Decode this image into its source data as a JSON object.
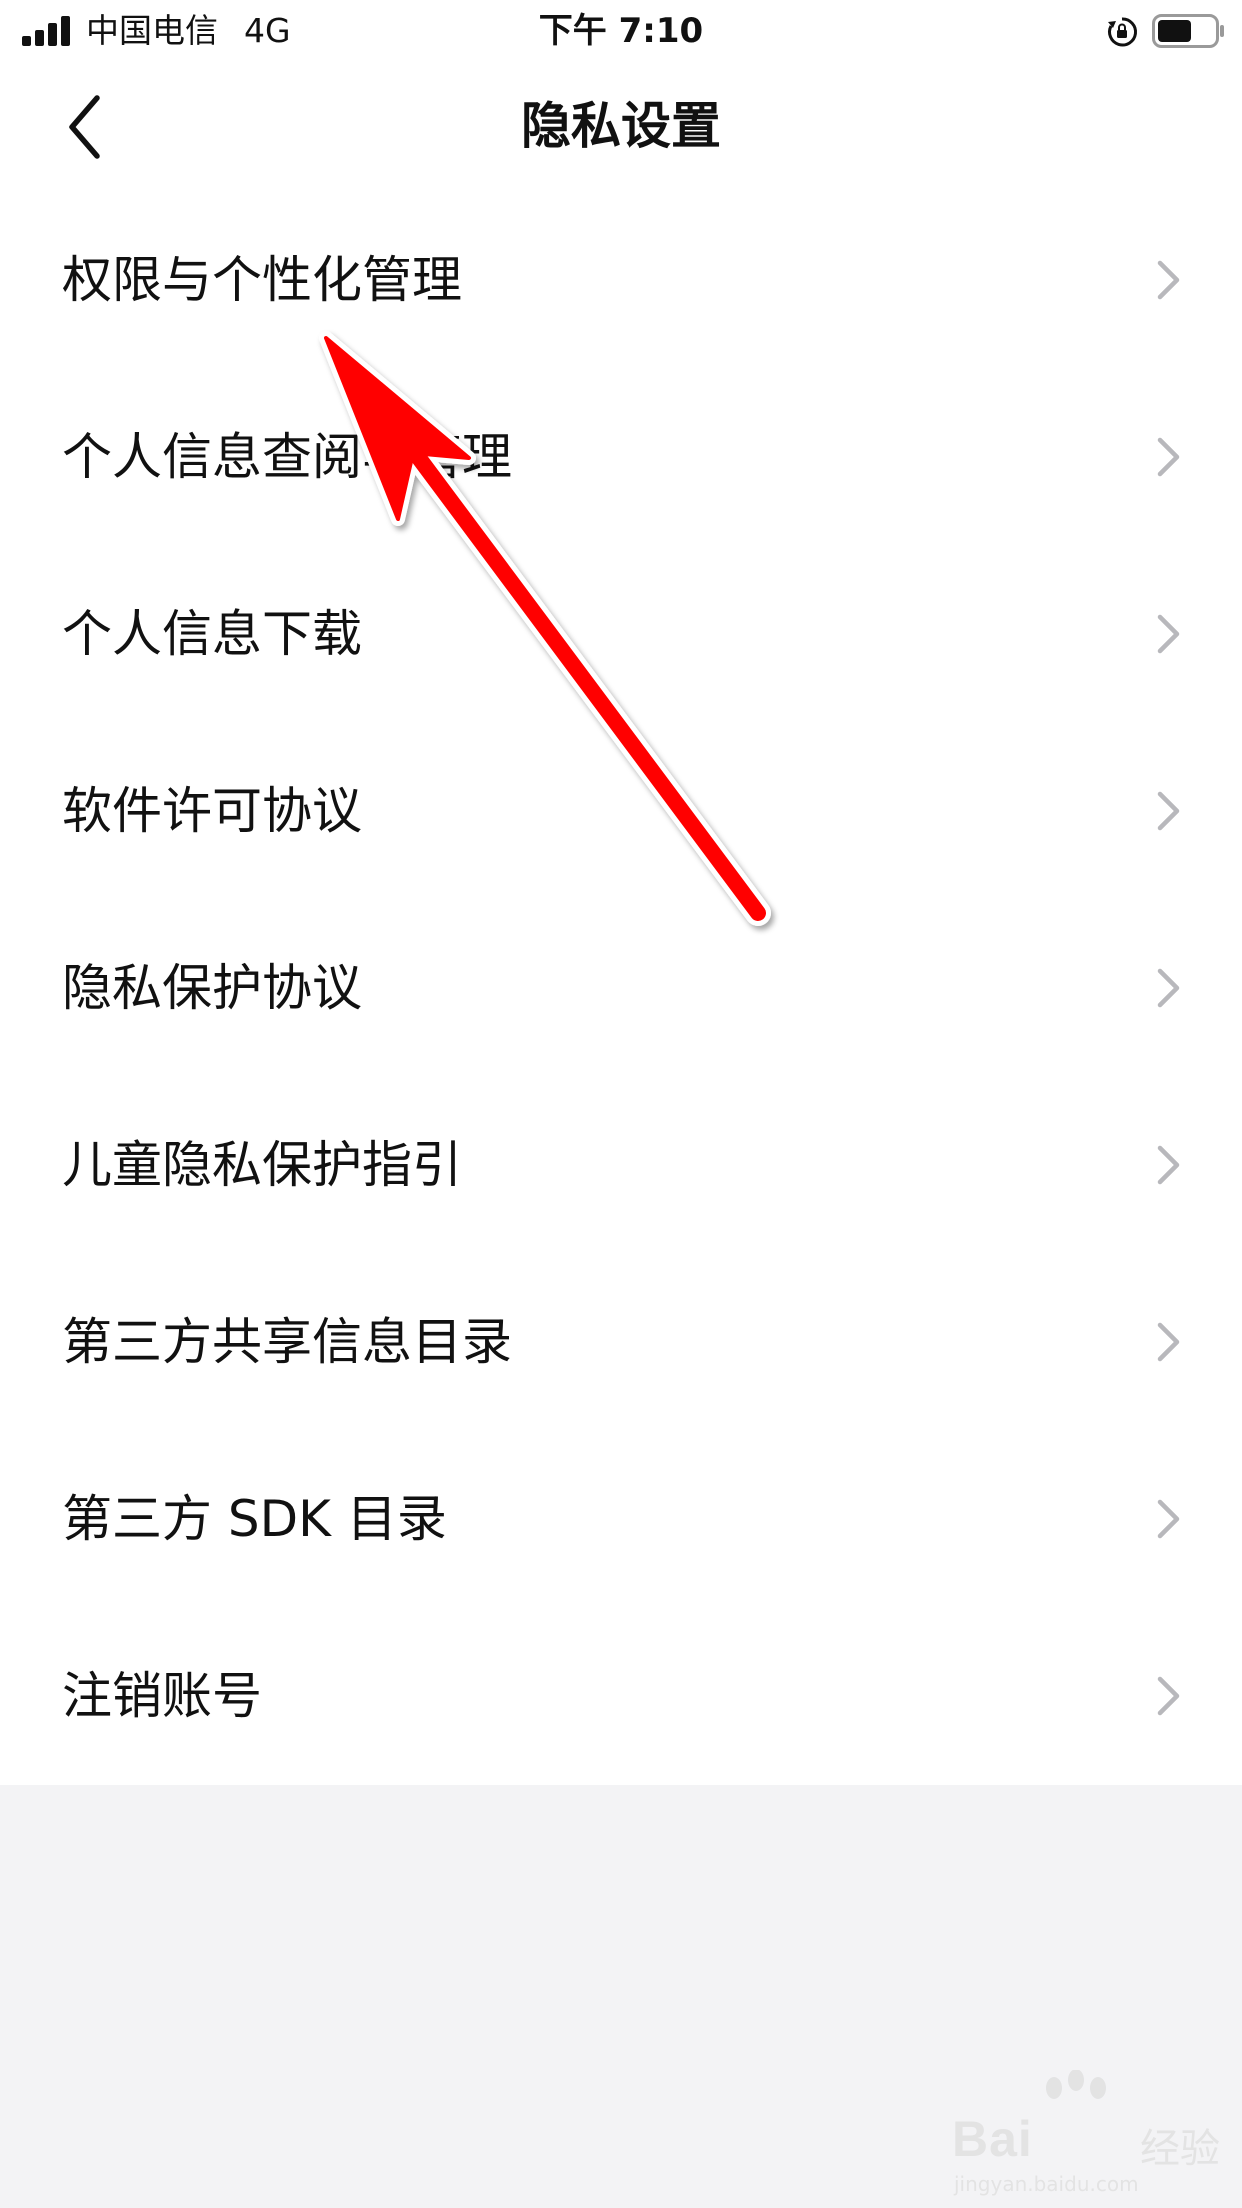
{
  "status_bar": {
    "carrier": "中国电信",
    "network": "4G",
    "time": "下午 7:10",
    "battery_level": 0.6
  },
  "nav": {
    "title": "隐私设置",
    "back_icon": "chevron-left-icon"
  },
  "list": {
    "items": [
      {
        "label": "权限与个性化管理"
      },
      {
        "label": "个人信息查阅与管理"
      },
      {
        "label": "个人信息下载"
      },
      {
        "label": "软件许可协议"
      },
      {
        "label": "隐私保护协议"
      },
      {
        "label": "儿童隐私保护指引"
      },
      {
        "label": "第三方共享信息目录"
      },
      {
        "label": "第三方 SDK 目录"
      },
      {
        "label": "注销账号"
      }
    ],
    "chevron_icon": "chevron-right-icon"
  },
  "colors": {
    "background": "#ffffff",
    "bottom_area": "#f3f3f5",
    "text": "#111111",
    "chevron": "#b8b8bc",
    "annotation_arrow": "#ff0000"
  },
  "watermark": {
    "brand": "Bai",
    "sub": "经验",
    "url": "jingyan.baidu.com"
  }
}
